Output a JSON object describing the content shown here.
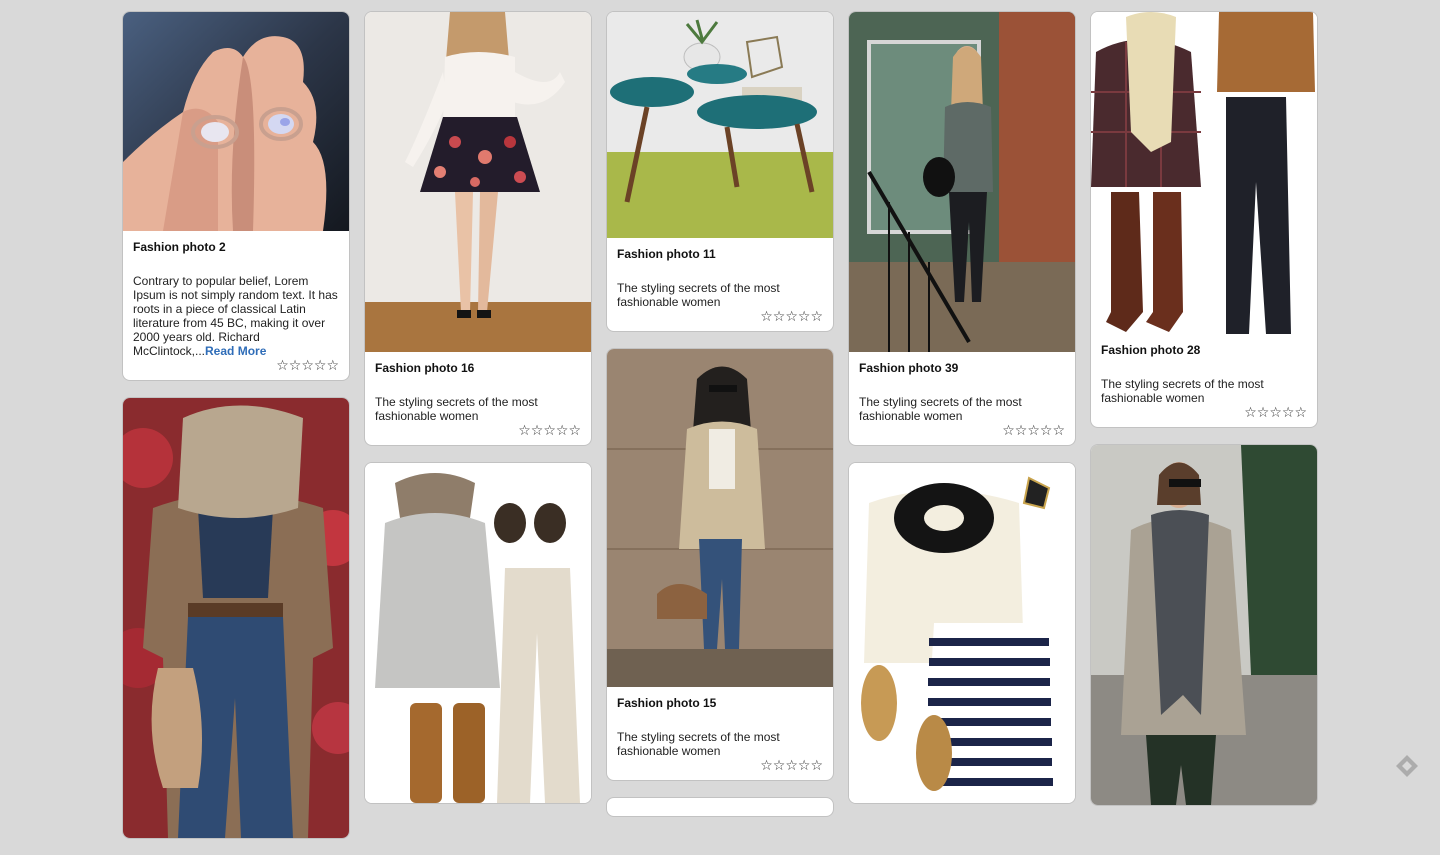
{
  "cards": {
    "c1": {
      "title": "Fashion photo 2",
      "description": "Contrary to popular belief, Lorem Ipsum is not simply random text. It has roots in a piece of classical Latin literature from 45 BC, making it over 2000 years old. Richard McClintock,...",
      "read_more": "Read More",
      "rating": "☆☆☆☆☆",
      "photo_icon": "rings-photo"
    },
    "c2": {
      "photo_icon": "scarf-blazer-outfit-photo"
    },
    "c3": {
      "title": "Fashion photo 16",
      "description": "The styling secrets of the most fashionable women",
      "rating": "☆☆☆☆☆",
      "photo_icon": "floral-skirt-photo"
    },
    "c4": {
      "photo_icon": "grey-sweater-outfit-photo"
    },
    "c5": {
      "title": "Fashion photo 11",
      "description": "The styling secrets of the most fashionable women",
      "rating": "☆☆☆☆☆",
      "photo_icon": "teal-table-photo"
    },
    "c6": {
      "title": "Fashion photo 15",
      "description": "The styling secrets of the most fashionable women",
      "rating": "☆☆☆☆☆",
      "photo_icon": "trench-coat-photo"
    },
    "c7": {
      "title": "Fashion photo 39",
      "description": "The styling secrets of the most fashionable women",
      "rating": "☆☆☆☆☆",
      "photo_icon": "stairs-outfit-photo"
    },
    "c8": {
      "photo_icon": "striped-skirt-outfit-photo"
    },
    "c9": {
      "title": "Fashion photo 28",
      "description": "The styling secrets of the most fashionable women",
      "rating": "☆☆☆☆☆",
      "photo_icon": "plaid-boots-outfit-photo"
    },
    "c10": {
      "photo_icon": "grey-scarf-cardigan-photo"
    }
  },
  "corner_icon": "feedly-icon"
}
